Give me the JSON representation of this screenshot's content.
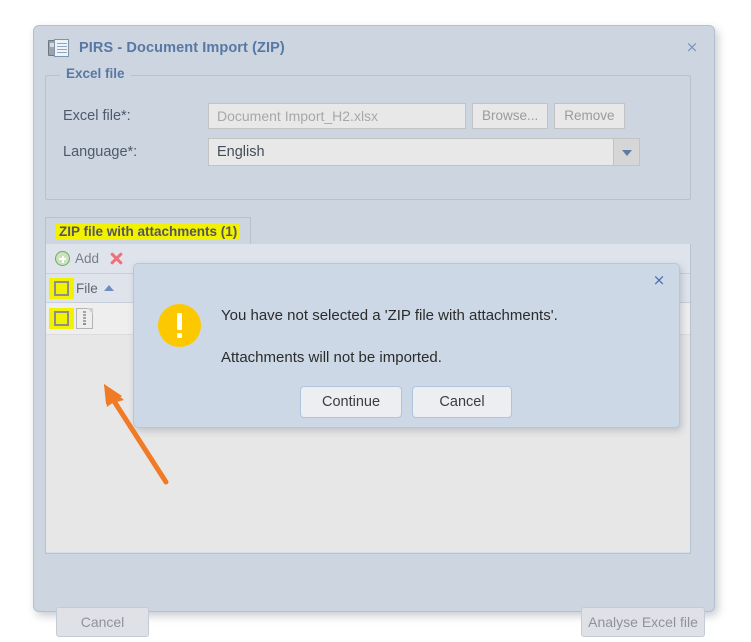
{
  "window": {
    "title": "PIRS - Document Import (ZIP)",
    "icon": "document-import-icon",
    "close_label": "×"
  },
  "excel_fieldset": {
    "legend": "Excel file",
    "rows": [
      {
        "label": "Excel file*:",
        "value": "Document Import_H2.xlsx",
        "placeholder": "Document Import_H2.xlsx",
        "browse_label": "Browse...",
        "remove_label": "Remove"
      },
      {
        "label": "Language*:",
        "value": "English",
        "options": [
          "English"
        ]
      }
    ]
  },
  "tab": {
    "label": "ZIP file with attachments (1)",
    "highlight_color": "#f2f200"
  },
  "grid": {
    "toolbar": {
      "add_label": "Add",
      "add_icon": "plus-circle-icon",
      "delete_icon": "delete-cross-icon"
    },
    "columns": [
      {
        "key": "select",
        "header": ""
      },
      {
        "key": "file",
        "header": "File",
        "sort": "asc"
      }
    ],
    "rows": [
      {
        "select": false,
        "file_icon": "zip-file-icon",
        "file": ""
      }
    ]
  },
  "footer": {
    "cancel_label": "Cancel",
    "analyse_label": "Analyse Excel file"
  },
  "modal": {
    "close_label": "×",
    "icon": "warning-exclamation-icon",
    "line1": "You have not selected a 'ZIP file with attachments'.",
    "line2": "Attachments will not be imported.",
    "continue_label": "Continue",
    "cancel_label": "Cancel"
  },
  "annotation": {
    "arrow_color": "#f07a26",
    "target": "row-select-checkbox"
  }
}
